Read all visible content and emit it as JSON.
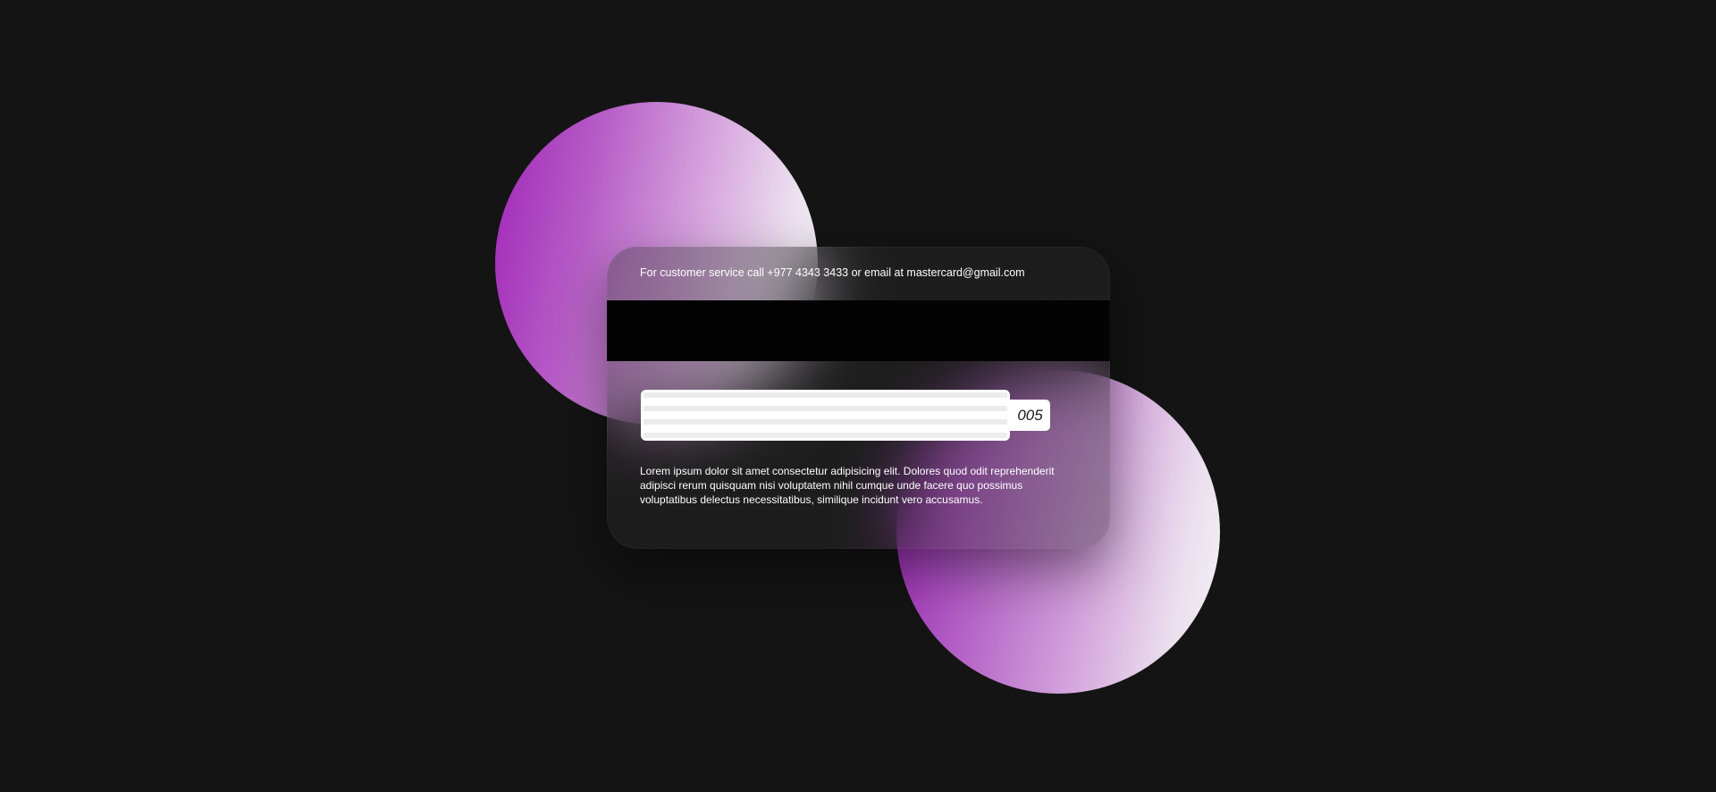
{
  "card": {
    "service_text": "For customer service call +977 4343 3433 or email at mastercard@gmail.com",
    "cvv": "005",
    "description": "Lorem ipsum dolor sit amet consectetur adipisicing elit. Dolores quod odit reprehenderit adipisci rerum quisquam nisi voluptatem nihil cumque unde facere quo possimus voluptatibus delectus necessitatibus, similique incidunt vero accusamus."
  },
  "colors": {
    "background": "#141414",
    "circle_start": "#a126b9",
    "circle_end": "#f2f0f4",
    "magnetic_stripe": "#030303",
    "signature_strip": "#ffffff"
  }
}
